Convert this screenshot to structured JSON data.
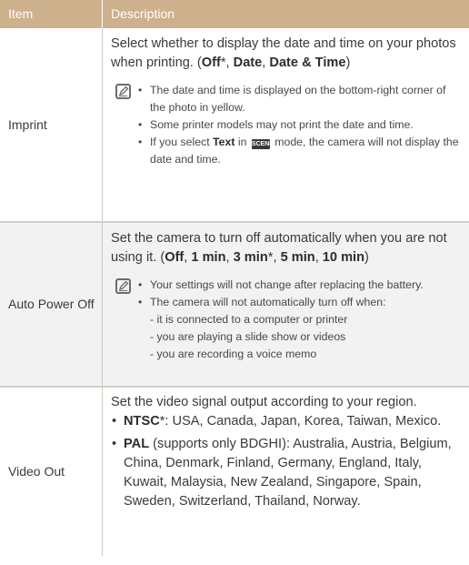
{
  "header": {
    "col1": "Item",
    "col2": "Description"
  },
  "rows": [
    {
      "item": "Imprint",
      "desc_text": "Select whether to display the date and time on your photos when printing. (",
      "options": [
        "Off",
        "*",
        ", ",
        "Date",
        ", ",
        "Date & Time",
        ")"
      ],
      "notes": [
        "The date and time is displayed on the bottom-right corner of the photo in yellow.",
        "Some printer models may not print the date and time.",
        {
          "pre": "If you select ",
          "bold": "Text",
          "mid": " in ",
          "icon": "SCENE",
          "post": " mode, the camera will not display the date and time."
        }
      ]
    },
    {
      "item": "Auto Power Off",
      "desc_text": "Set the camera to turn off automatically when you are not using it. (",
      "options": [
        "Off",
        ", ",
        "1 min",
        ", ",
        "3 min",
        "*",
        ", ",
        "5 min",
        ", ",
        "10 min",
        ")"
      ],
      "notes": [
        "Your settings will not change after replacing the battery.",
        "The camera will not automatically turn off when:"
      ],
      "sub_notes": [
        "- it is connected to a computer or printer",
        "- you are playing a slide show or videos",
        "- you are recording a voice memo"
      ]
    },
    {
      "item": "Video Out",
      "desc_text": "Set the video signal output according to your region.",
      "bullets": [
        {
          "bold": "NTSC",
          "star": "*",
          "text": ": USA, Canada, Japan, Korea, Taiwan, Mexico."
        },
        {
          "bold": "PAL",
          "text": " (supports only BDGHI): Australia, Austria, Belgium, China, Denmark, Finland, Germany, England, Italy, Kuwait, Malaysia, New Zealand, Singapore, Spain, Sweden, Switzerland, Thailand, Norway."
        }
      ]
    }
  ],
  "icons": {
    "note": "note-pencil-icon",
    "scene": "scene-mode-icon"
  },
  "colors": {
    "header_bg": "#cdb08c",
    "alt_row_bg": "#f2f2f2"
  }
}
